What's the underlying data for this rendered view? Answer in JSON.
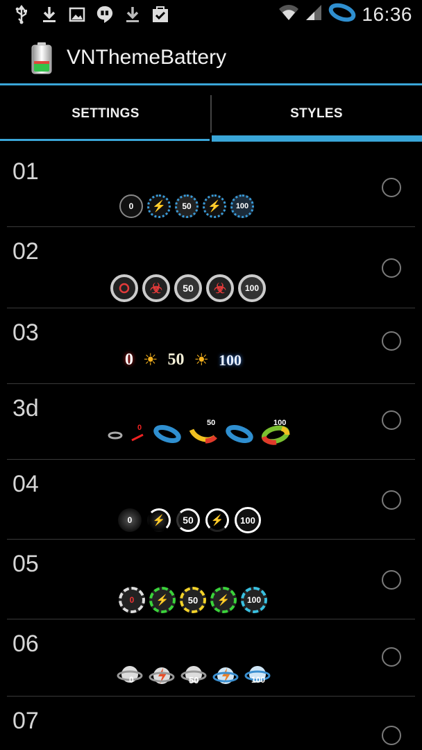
{
  "status_bar": {
    "time": "16:36",
    "left_icons": [
      "usb-icon",
      "download-icon",
      "image-icon",
      "hangouts-icon",
      "download-icon",
      "clipboard-check-icon"
    ],
    "right_icons": [
      "wifi-icon",
      "signal-icon",
      "battery-ring-icon"
    ]
  },
  "app": {
    "title": "VNThemeBattery",
    "accent": "#3aa6d8"
  },
  "tabs": [
    {
      "label": "SETTINGS",
      "selected": false
    },
    {
      "label": "STYLES",
      "selected": true
    }
  ],
  "styles": [
    {
      "name": "01",
      "preview_labels": [
        "0",
        "",
        "50",
        "",
        "100"
      ]
    },
    {
      "name": "02",
      "preview_labels": [
        "",
        "",
        "50",
        "",
        "100"
      ]
    },
    {
      "name": "03",
      "preview_labels": [
        "0",
        "",
        "50",
        "",
        "100"
      ]
    },
    {
      "name": "3d",
      "preview_labels": [
        "",
        "0",
        "",
        "50",
        "",
        "100"
      ]
    },
    {
      "name": "04",
      "preview_labels": [
        "0",
        "",
        "50",
        "",
        "100"
      ]
    },
    {
      "name": "05",
      "preview_labels": [
        "0",
        "",
        "50",
        "",
        "100"
      ]
    },
    {
      "name": "06",
      "preview_labels": [
        "0",
        "",
        "50",
        "",
        "100"
      ]
    },
    {
      "name": "07",
      "preview_labels": []
    }
  ]
}
